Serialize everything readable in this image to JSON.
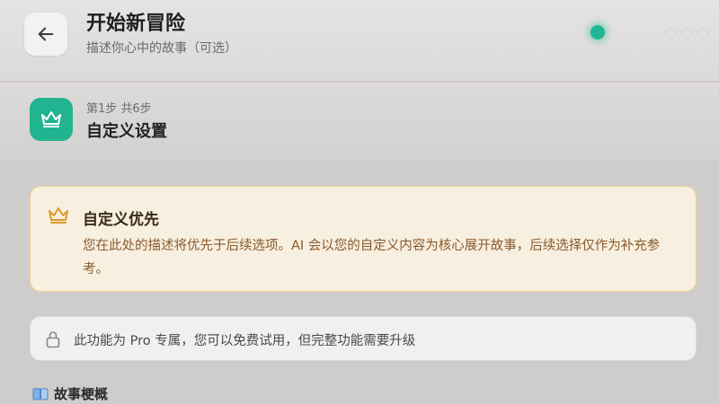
{
  "header": {
    "title": "开始新冒险",
    "subtitle": "描述你心中的故事（可选）",
    "accent_color": "#20b894"
  },
  "step": {
    "count_label": "第1步 共6步",
    "title": "自定义设置",
    "icon": "crown-icon",
    "icon_bg": "#22b491"
  },
  "notice": {
    "title": "自定义优先",
    "body": "您在此处的描述将优先于后续选项。AI 会以您的自定义内容为核心展开故事，后续选择仅作为补充参考。",
    "icon": "crown-icon",
    "border_color": "#efcf93"
  },
  "pro_notice": {
    "text": "此功能为 Pro 专属，您可以免费试用，但完整功能需要升级",
    "icon": "lock-icon"
  },
  "section": {
    "label": "故事梗概",
    "icon": "book-icon"
  }
}
